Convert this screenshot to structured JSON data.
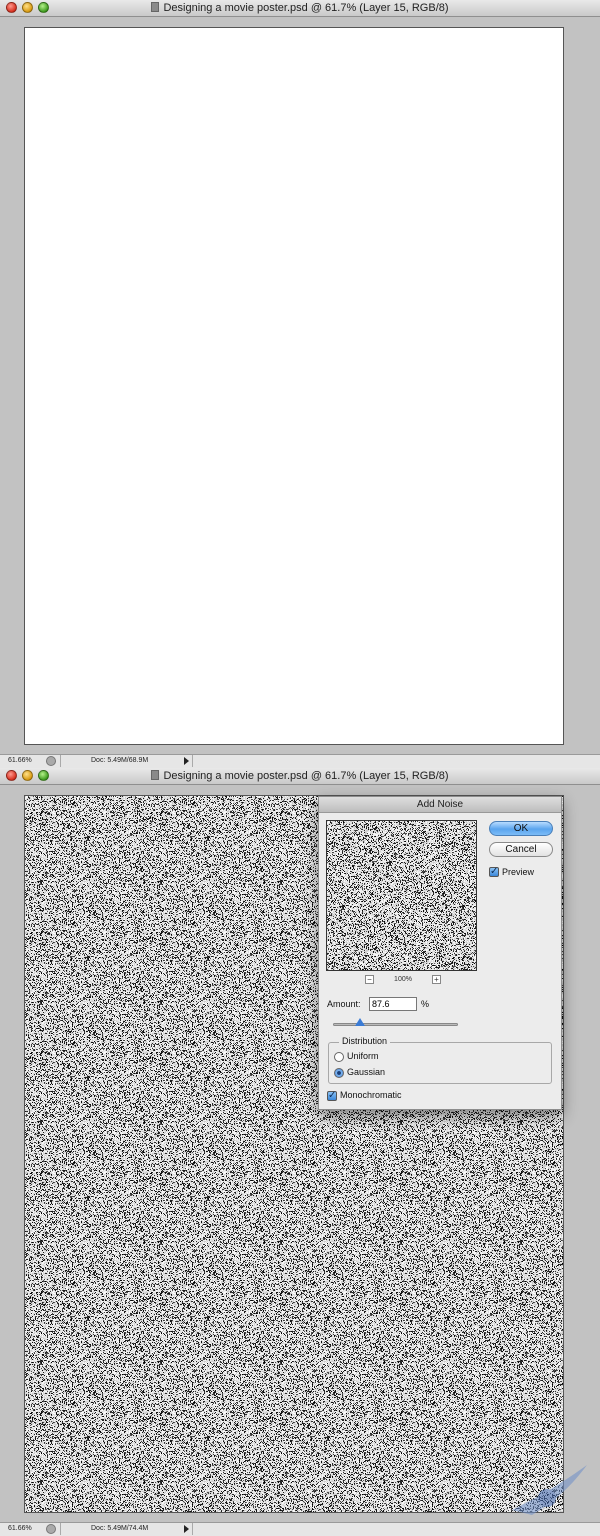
{
  "window_top": {
    "title": "Designing a movie poster.psd @ 61.7% (Layer 15, RGB/8)",
    "status": {
      "zoom": "61.66%",
      "doc": "Doc: 5.49M/68.9M"
    }
  },
  "window_bottom": {
    "title": "Designing a movie poster.psd @ 61.7% (Layer 15, RGB/8)",
    "status": {
      "zoom": "61.66%",
      "doc": "Doc: 5.49M/74.4M"
    }
  },
  "dialog": {
    "title": "Add Noise",
    "ok_label": "OK",
    "cancel_label": "Cancel",
    "preview_label": "Preview",
    "preview_checked": true,
    "preview_zoom": "100%",
    "amount_label": "Amount:",
    "amount_value": "87.6",
    "amount_unit": "%",
    "distribution_label": "Distribution",
    "distribution_options": [
      "Uniform",
      "Gaussian"
    ],
    "distribution_selected": "Gaussian",
    "monochromatic_label": "Monochromatic",
    "monochromatic_checked": true
  },
  "colors": {
    "ok_button": "#5aa4ee",
    "window_bg": "#c2c2c2",
    "canvas_bg": "#ffffff"
  }
}
